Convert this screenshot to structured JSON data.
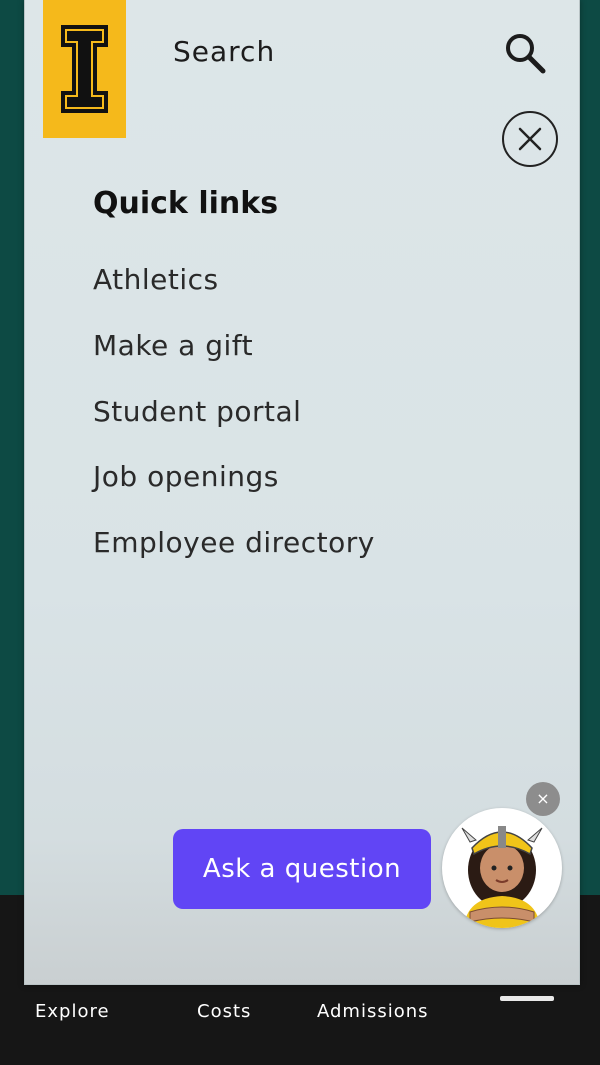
{
  "header": {
    "search_label": "Search"
  },
  "quick_links": {
    "title": "Quick links",
    "items": [
      "Athletics",
      "Make a gift",
      "Student portal",
      "Job openings",
      "Employee directory"
    ]
  },
  "chat": {
    "ask_label": "Ask a question",
    "dismiss_glyph": "×"
  },
  "bottom_nav": {
    "items": [
      "Explore",
      "Costs",
      "Admissions"
    ]
  },
  "colors": {
    "brand_gold": "#f5b91b",
    "background_teal": "#0d4a44",
    "ask_button": "#6145f5"
  },
  "icons": [
    "university-logo-icon",
    "search-icon",
    "close-icon",
    "mascot-avatar-icon",
    "menu-icon"
  ]
}
